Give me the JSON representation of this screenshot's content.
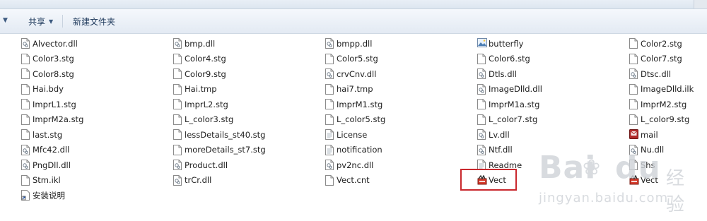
{
  "window": {
    "title": ""
  },
  "toolbar": {
    "share_label": "共享",
    "new_folder_label": "新建文件夹"
  },
  "watermark": {
    "brand": "Bai",
    "brand_suffix": "du",
    "brand_cn": "经验",
    "url": "jingyan.baidu.com"
  },
  "files": [
    {
      "name": "Alvector.dll",
      "icon": "dll-icon"
    },
    {
      "name": "Color3.stg",
      "icon": "file-icon"
    },
    {
      "name": "Color8.stg",
      "icon": "file-icon"
    },
    {
      "name": "Hai.bdy",
      "icon": "file-icon"
    },
    {
      "name": "ImprL1.stg",
      "icon": "file-icon"
    },
    {
      "name": "ImprM2a.stg",
      "icon": "file-icon"
    },
    {
      "name": "last.stg",
      "icon": "file-icon"
    },
    {
      "name": "Mfc42.dll",
      "icon": "dll-icon"
    },
    {
      "name": "PngDll.dll",
      "icon": "dll-icon"
    },
    {
      "name": "Stm.ikl",
      "icon": "file-icon"
    },
    {
      "name": "安装说明",
      "icon": "shortcut-icon"
    },
    {
      "name": "bmp.dll",
      "icon": "dll-icon"
    },
    {
      "name": "Color4.stg",
      "icon": "file-icon"
    },
    {
      "name": "Color9.stg",
      "icon": "file-icon"
    },
    {
      "name": "Hai.tmp",
      "icon": "file-icon"
    },
    {
      "name": "ImprL2.stg",
      "icon": "file-icon"
    },
    {
      "name": "L_color3.stg",
      "icon": "file-icon"
    },
    {
      "name": "lessDetails_st40.stg",
      "icon": "file-icon"
    },
    {
      "name": "moreDetails_st7.stg",
      "icon": "file-icon"
    },
    {
      "name": "Product.dll",
      "icon": "dll-icon"
    },
    {
      "name": "trCr.dll",
      "icon": "dll-icon"
    },
    {
      "name": "bmpp.dll",
      "icon": "dll-icon"
    },
    {
      "name": "Color5.stg",
      "icon": "file-icon"
    },
    {
      "name": "crvCnv.dll",
      "icon": "dll-icon"
    },
    {
      "name": "hai7.tmp",
      "icon": "file-icon"
    },
    {
      "name": "ImprM1.stg",
      "icon": "file-icon"
    },
    {
      "name": "L_color5.stg",
      "icon": "file-icon"
    },
    {
      "name": "License",
      "icon": "text-file-icon"
    },
    {
      "name": "notification",
      "icon": "text-file-icon"
    },
    {
      "name": "pv2nc.dll",
      "icon": "dll-icon"
    },
    {
      "name": "Vect.cnt",
      "icon": "file-icon"
    },
    {
      "name": "butterfly",
      "icon": "image-file-icon"
    },
    {
      "name": "Color6.stg",
      "icon": "file-icon"
    },
    {
      "name": "Dtls.dll",
      "icon": "dll-icon"
    },
    {
      "name": "ImageDlld.dll",
      "icon": "dll-icon"
    },
    {
      "name": "ImprM1a.stg",
      "icon": "file-icon"
    },
    {
      "name": "L_color7.stg",
      "icon": "file-icon"
    },
    {
      "name": "Lv.dll",
      "icon": "dll-icon"
    },
    {
      "name": "Ntf.dll",
      "icon": "dll-icon"
    },
    {
      "name": "Readme",
      "icon": "text-file-icon"
    },
    {
      "name": "Vect",
      "icon": "vect-app-icon"
    },
    {
      "name": "Color2.stg",
      "icon": "file-icon"
    },
    {
      "name": "Color7.stg",
      "icon": "file-icon"
    },
    {
      "name": "Dtsc.dll",
      "icon": "dll-icon"
    },
    {
      "name": "ImageDlld.ilk",
      "icon": "file-icon"
    },
    {
      "name": "ImprM2.stg",
      "icon": "file-icon"
    },
    {
      "name": "L_color9.stg",
      "icon": "file-icon"
    },
    {
      "name": "mail",
      "icon": "mail-app-icon"
    },
    {
      "name": "Nu.dll",
      "icon": "dll-icon"
    },
    {
      "name": "Shs",
      "icon": "file-icon"
    },
    {
      "name": "Vect",
      "icon": "vect-app-icon"
    }
  ]
}
